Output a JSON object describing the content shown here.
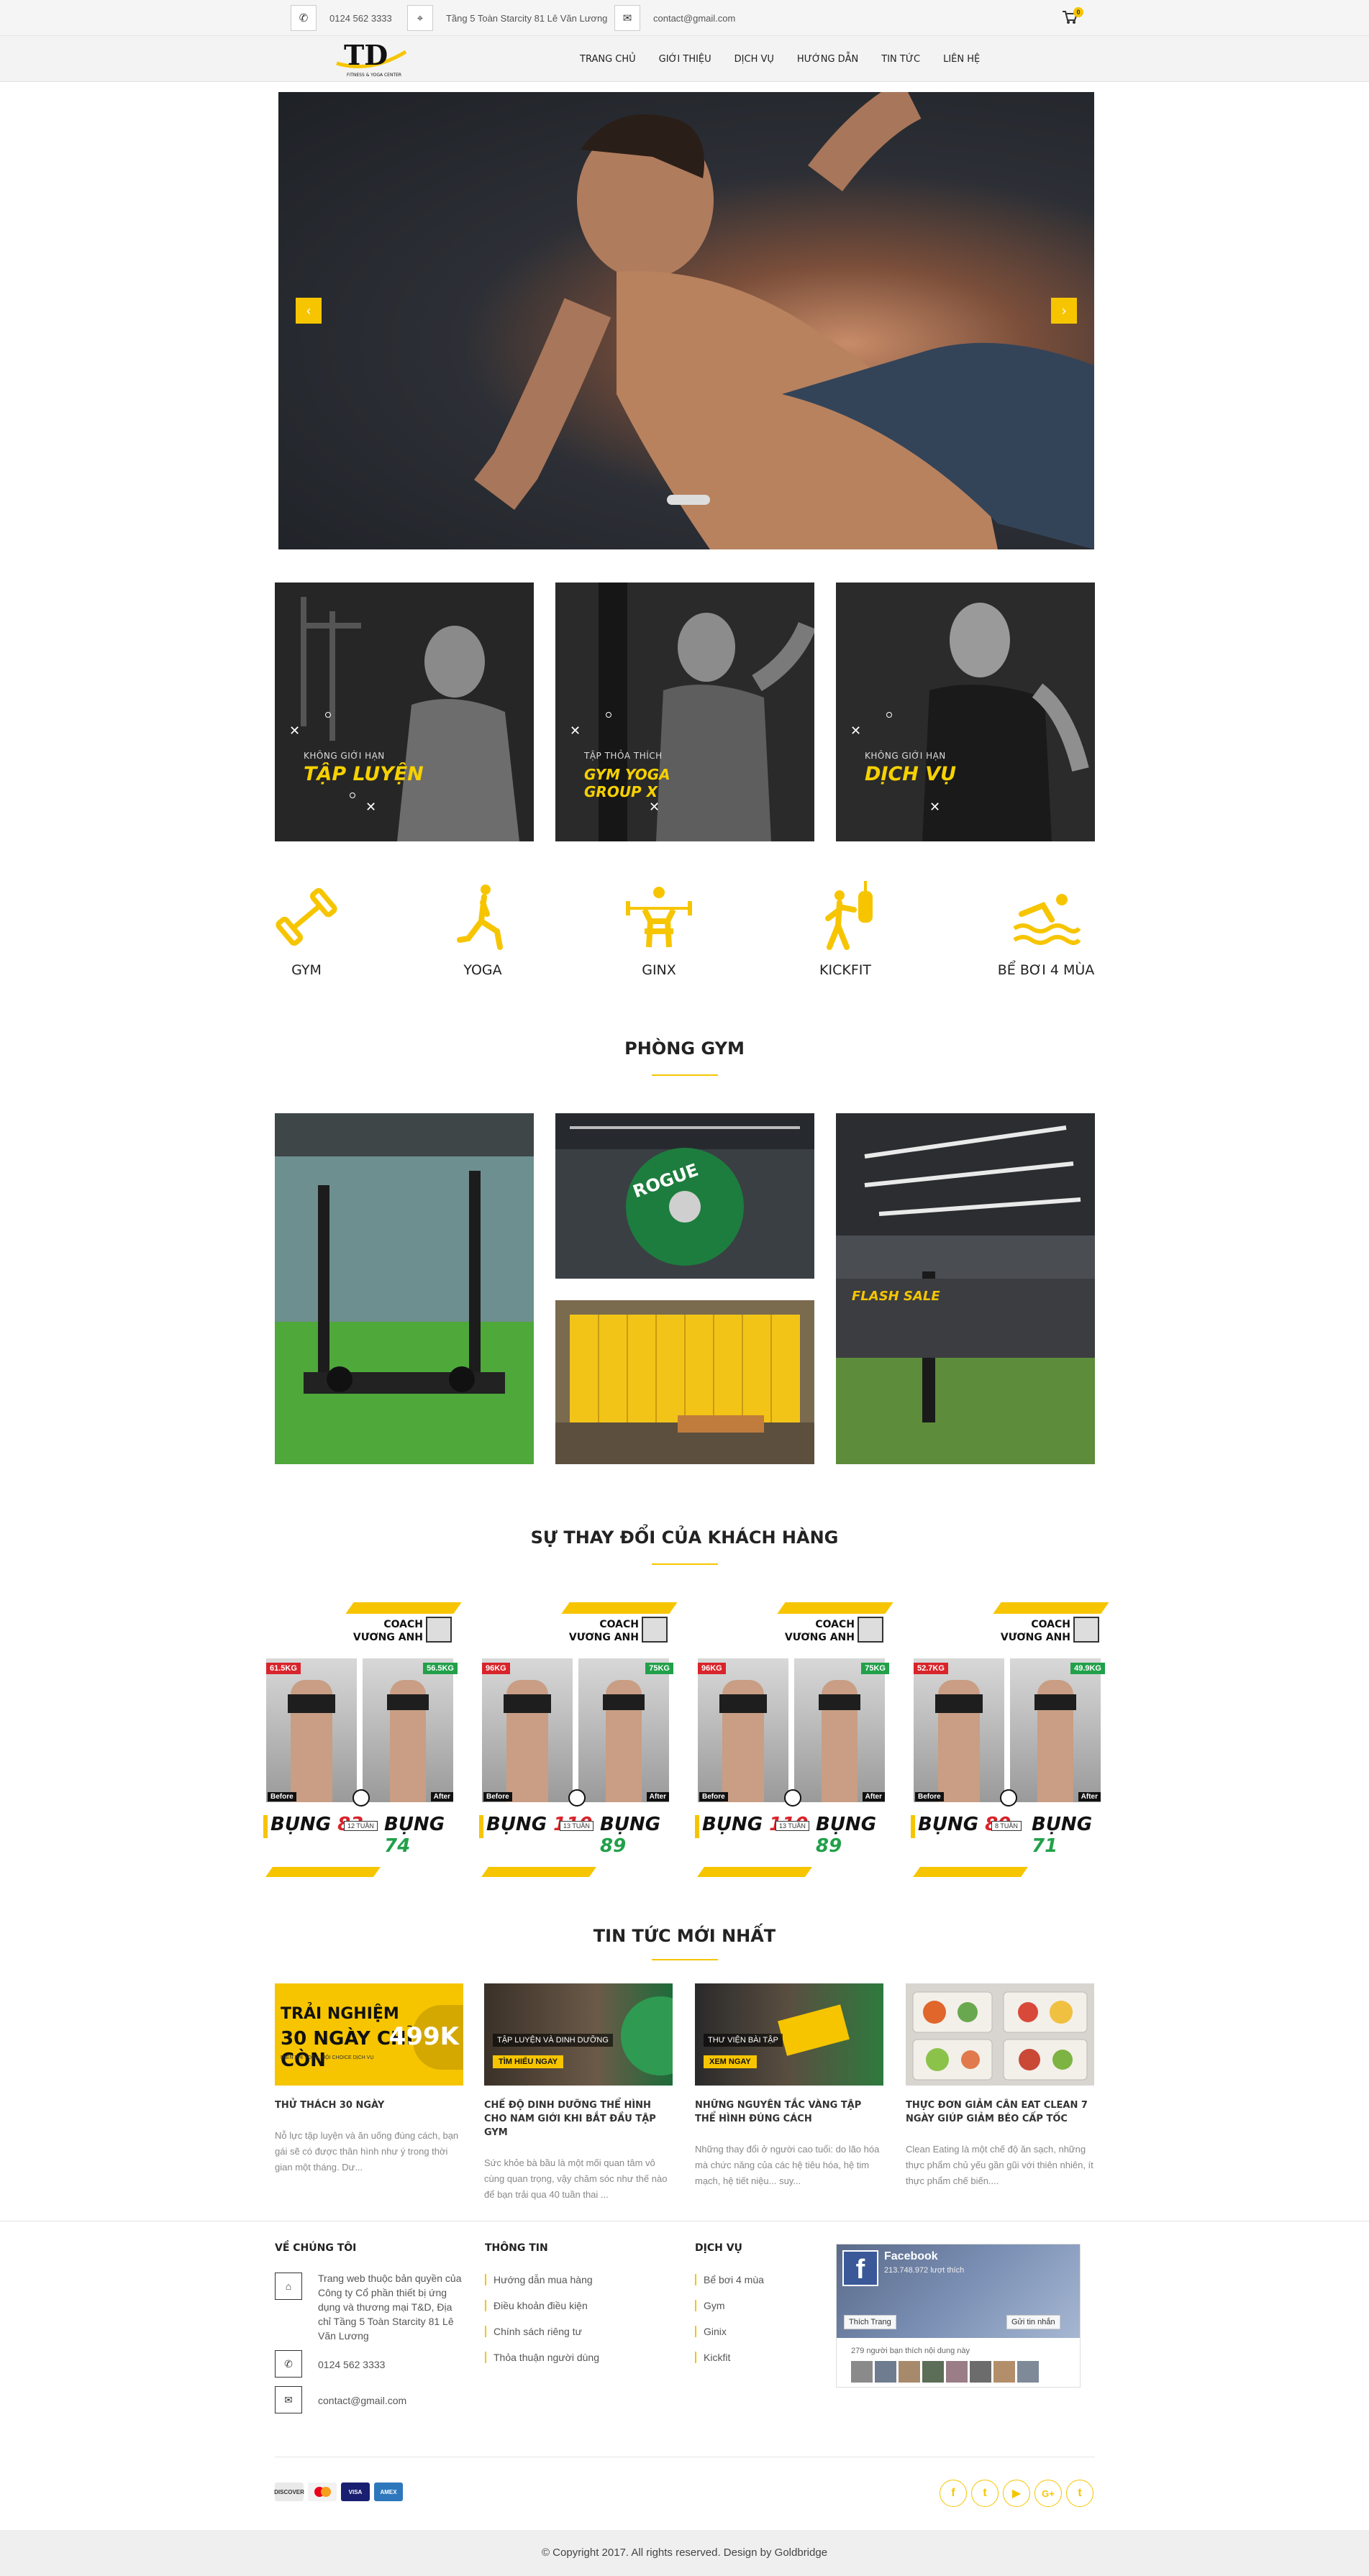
{
  "topbar": {
    "phone": "0124 562 3333",
    "address": "Tầng 5 Toàn Starcity 81 Lê Văn Lương",
    "email": "contact@gmail.com",
    "cart_count": "0"
  },
  "logo": {
    "letters": "TD",
    "tagline": "FITNESS & YOGA CENTER"
  },
  "nav": {
    "items": [
      "TRANG CHỦ",
      "GIỚI THIỆU",
      "DỊCH VỤ",
      "HƯỚNG DẪN",
      "TIN TỨC",
      "LIÊN HỆ"
    ]
  },
  "hero": {
    "prev_icon": "chevron-left-icon",
    "next_icon": "chevron-right-icon"
  },
  "banners": [
    {
      "sub": "KHÔNG GIỚI HẠN",
      "title": "TẬP LUYỆN",
      "title2": ""
    },
    {
      "sub": "TẬP THỎA THÍCH",
      "title": "GYM YOGA",
      "title2": "GROUP X"
    },
    {
      "sub": "KHÔNG GIỚI HẠN",
      "title": "DỊCH VỤ",
      "title2": ""
    }
  ],
  "services": [
    {
      "label": "GYM",
      "icon": "dumbbell-icon"
    },
    {
      "label": "YOGA",
      "icon": "yoga-icon"
    },
    {
      "label": "GINX",
      "icon": "weightlifter-icon"
    },
    {
      "label": "KICKFIT",
      "icon": "punching-bag-icon"
    },
    {
      "label": "BỂ BƠI 4 MÙA",
      "icon": "swimming-icon"
    }
  ],
  "sections": {
    "gym_title": "PHÒNG GYM",
    "transform_title": "SỰ THAY ĐỔI CỦA KHÁCH HÀNG",
    "news_title": "TIN TỨC MỚI NHẤT"
  },
  "gym_photos": {
    "flash_sale": "FLASH SALE",
    "plate_text": "ROGUE"
  },
  "transforms": [
    {
      "coach": "COACH",
      "name": "VƯƠNG ANH",
      "before_kg": "61.5KG",
      "after_kg": "56.5KG",
      "before": "Before",
      "after": "After",
      "bung": "BỤNG",
      "before_val": "83",
      "after_val": "74",
      "weeks": "12 TUẦN"
    },
    {
      "coach": "COACH",
      "name": "VƯƠNG ANH",
      "before_kg": "96KG",
      "after_kg": "75KG",
      "before": "Before",
      "after": "After",
      "bung": "BỤNG",
      "before_val": "110",
      "after_val": "89",
      "weeks": "13 TUẦN"
    },
    {
      "coach": "COACH",
      "name": "VƯƠNG ANH",
      "before_kg": "96KG",
      "after_kg": "75KG",
      "before": "Before",
      "after": "After",
      "bung": "BỤNG",
      "before_val": "110",
      "after_val": "89",
      "weeks": "13 TUẦN"
    },
    {
      "coach": "COACH",
      "name": "VƯƠNG ANH",
      "before_kg": "52.7KG",
      "after_kg": "49.9KG",
      "before": "Before",
      "after": "After",
      "bung": "BỤNG",
      "before_val": "80",
      "after_val": "71",
      "weeks": "8 TUẦN"
    }
  ],
  "news": [
    {
      "img_line1": "TRẢI NGHIỆM",
      "img_line2": "30 NGÀY CHỈ CÒN",
      "img_price": "499K",
      "img_small": "MIỄN PHÍ YOGA, HỘI CHOICE DỊCH VỤ",
      "title": "THỬ THÁCH 30 NGÀY",
      "desc": "Nỗ lực tập luyện và ăn uống đúng cách, bạn gái sẽ có được thân hình như ý trong thời gian một tháng. Dư..."
    },
    {
      "img_label": "TẬP LUYỆN VÀ DINH DƯỠNG",
      "img_btn": "TÌM HIỂU NGAY",
      "title": "CHẾ ĐỘ DINH DƯỠNG THỂ HÌNH CHO NAM GIỚI KHI BẮT ĐẦU TẬP GYM",
      "desc": "Sức khỏe bà bầu là một mối quan tâm vô cùng quan trọng, vậy chăm sóc như thế nào để bạn trải qua 40 tuần thai ..."
    },
    {
      "img_label": "THƯ VIỆN BÀI TẬP",
      "img_btn": "XEM NGAY",
      "title": "NHỮNG NGUYÊN TẮC VÀNG TẬP THỂ HÌNH ĐÚNG CÁCH",
      "desc": "Những thay đổi ở người cao tuổi: do lão hóa mà chức năng của các hệ tiêu hóa, hệ tim mạch, hệ tiết niệu... suy..."
    },
    {
      "title": "THỰC ĐƠN GIẢM CÂN EAT CLEAN 7 NGÀY GIÚP GIẢM BÉO CẤP TỐC",
      "desc": "Clean Eating là một chế độ ăn sạch, những thực phẩm chủ yếu gần gũi với thiên nhiên, ít thực phẩm chế biến...."
    }
  ],
  "footer": {
    "about_head": "VỀ CHÚNG TÔI",
    "about_text": "Trang web thuộc bản quyền của Công ty Cổ phần thiết bị ứng dụng và thương mại T&D, Địa chỉ Tầng 5 Toàn Starcity 81 Lê Văn Lương",
    "phone": "0124 562 3333",
    "email": "contact@gmail.com",
    "info_head": "THÔNG TIN",
    "info_links": [
      "Hướng dẫn mua hàng",
      "Điều khoản điều kiện",
      "Chính sách riêng tư",
      "Thỏa thuận người dùng"
    ],
    "service_head": "DỊCH VỤ",
    "service_links": [
      "Bể bơi 4 mùa",
      "Gym",
      "Ginix",
      "Kickfit"
    ],
    "fb": {
      "name": "Facebook",
      "likes": "213.748.972 lượt thích",
      "like_btn": "Thích Trang",
      "msg_btn": "Gửi tin nhắn",
      "friends": "279 người bạn thích nội dung này"
    },
    "payments": [
      "DISCOVER",
      "MC",
      "VISA",
      "AMEX"
    ],
    "social_icons": [
      "facebook-icon",
      "twitter-icon",
      "youtube-icon",
      "google-plus-icon",
      "tumblr-icon"
    ],
    "social_glyphs": [
      "f",
      "t",
      "▶",
      "G+",
      "t"
    ],
    "copyright": "© Copyright 2017. All rights reserved. Design by Goldbridge"
  }
}
